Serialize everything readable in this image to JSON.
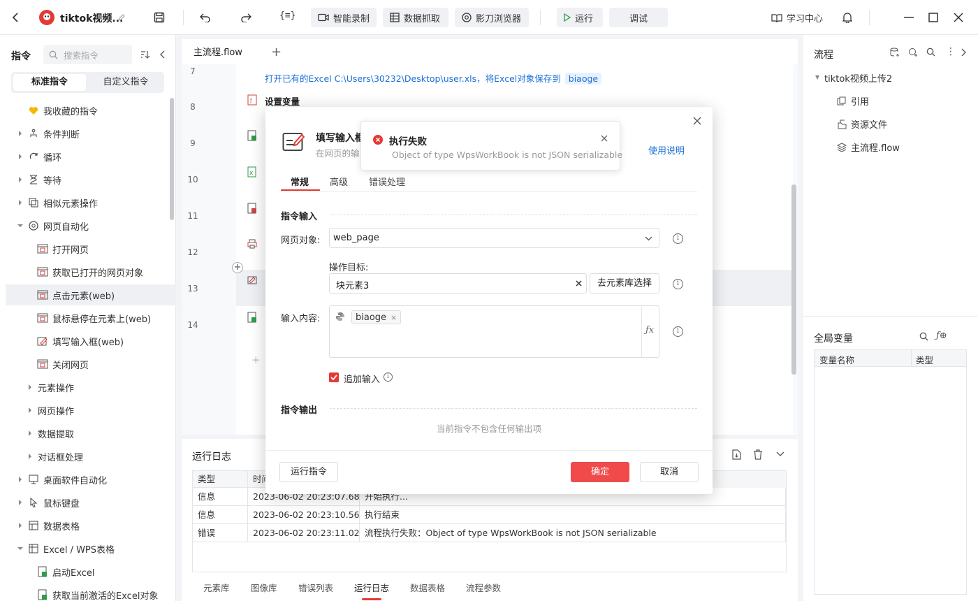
{
  "window": {
    "title": "tiktok视频...",
    "buttons": {
      "smart_record": "智能录制",
      "data_capture": "数据抓取",
      "browser": "影刀浏览器",
      "run": "运行",
      "debug": "调试",
      "learning": "学习中心",
      "code": "{≡}"
    }
  },
  "left": {
    "title": "指令",
    "search_placeholder": "搜索指令",
    "tabs": {
      "standard": "标准指令",
      "custom": "自定义指令"
    },
    "items": [
      {
        "label": "我收藏的指令",
        "icon": "heart-icon",
        "level": 0,
        "caret": ""
      },
      {
        "label": "条件判断",
        "icon": "branch-icon",
        "level": 0,
        "caret": "right"
      },
      {
        "label": "循环",
        "icon": "loop-icon",
        "level": 0,
        "caret": "right"
      },
      {
        "label": "等待",
        "icon": "hourglass-icon",
        "level": 0,
        "caret": "right"
      },
      {
        "label": "相似元素操作",
        "icon": "similar-icon",
        "level": 0,
        "caret": "right"
      },
      {
        "label": "网页自动化",
        "icon": "browser-icon",
        "level": 0,
        "caret": "down"
      },
      {
        "label": "打开网页",
        "icon": "webpage-icon",
        "level": 2,
        "caret": ""
      },
      {
        "label": "获取已打开的网页对象",
        "icon": "webpage-icon",
        "level": 2,
        "caret": ""
      },
      {
        "label": "点击元素(web)",
        "icon": "webpage-icon",
        "level": 2,
        "caret": "",
        "selected": true
      },
      {
        "label": "鼠标悬停在元素上(web)",
        "icon": "webpage-icon",
        "level": 2,
        "caret": ""
      },
      {
        "label": "填写输入框(web)",
        "icon": "edit-icon",
        "level": 2,
        "caret": ""
      },
      {
        "label": "关闭网页",
        "icon": "webpage-icon",
        "level": 2,
        "caret": ""
      },
      {
        "label": "元素操作",
        "icon": "",
        "level": 1,
        "caret": "right"
      },
      {
        "label": "网页操作",
        "icon": "",
        "level": 1,
        "caret": "right"
      },
      {
        "label": "数据提取",
        "icon": "",
        "level": 1,
        "caret": "right"
      },
      {
        "label": "对话框处理",
        "icon": "",
        "level": 1,
        "caret": "right"
      },
      {
        "label": "桌面软件自动化",
        "icon": "desktop-icon",
        "level": 0,
        "caret": "right"
      },
      {
        "label": "鼠标键盘",
        "icon": "cursor-icon",
        "level": 0,
        "caret": "right"
      },
      {
        "label": "数据表格",
        "icon": "table-icon",
        "level": 0,
        "caret": "right"
      },
      {
        "label": "Excel / WPS表格",
        "icon": "excel-icon",
        "level": 0,
        "caret": "down"
      },
      {
        "label": "启动Excel",
        "icon": "excel-file-icon",
        "level": 2,
        "caret": ""
      },
      {
        "label": "获取当前激活的Excel对象",
        "icon": "excel-file-icon",
        "level": 2,
        "caret": ""
      }
    ]
  },
  "editor": {
    "tab": "主流程.flow",
    "add_tab": "+",
    "line7_text": "打开已有的Excel C:\\Users\\30232\\Desktop\\user.xls，将Excel对象保存到",
    "line7_var": "biaoge",
    "line8_title": "设置变量",
    "line_numbers": [
      "7",
      "8",
      "9",
      "10",
      "11",
      "12",
      "13",
      "14"
    ]
  },
  "dialog": {
    "title": "填写输入框",
    "subtitle": "在网页的输",
    "help": "使用说明",
    "tabs": [
      "常规",
      "高级",
      "错误处理"
    ],
    "section_input": "指令输入",
    "web_object_label": "网页对象:",
    "web_object_value": "web_page",
    "target_label": "操作目标:",
    "target_value": "块元素3",
    "target_button": "去元素库选择",
    "content_label": "输入内容:",
    "content_tag": "biaoge",
    "fx": "ƒx",
    "append_label": "追加输入",
    "section_output": "指令输出",
    "output_empty": "当前指令不包含任何输出项",
    "run_button": "运行指令",
    "ok_button": "确定",
    "cancel_button": "取消"
  },
  "toast": {
    "title": "执行失败",
    "message": "Object of type WpsWorkBook is not JSON serializable"
  },
  "log": {
    "title": "运行日志",
    "headers": [
      "类型",
      "时间"
    ],
    "rows": [
      {
        "type": "信息",
        "time": "2023-06-02 20:23:07.687",
        "msg": "开始执行..."
      },
      {
        "type": "信息",
        "time": "2023-06-02 20:23:10.565",
        "msg": "执行结束"
      },
      {
        "type": "错误",
        "time": "2023-06-02 20:23:11.021",
        "msg": "流程执行失败：Object of type WpsWorkBook is not JSON serializable"
      }
    ],
    "bottom_tabs": [
      "元素库",
      "图像库",
      "错误列表",
      "运行日志",
      "数据表格",
      "流程参数"
    ]
  },
  "right": {
    "flow_title": "流程",
    "tree": {
      "root": "tiktok视频上传2",
      "children": [
        "引用",
        "资源文件",
        "主流程.flow"
      ]
    },
    "globals_title": "全局变量",
    "globals_headers": [
      "变量名称",
      "类型"
    ]
  },
  "colors": {
    "accent": "#1a73e8",
    "primary_red": "#f04a4a",
    "error": "#e53935"
  }
}
